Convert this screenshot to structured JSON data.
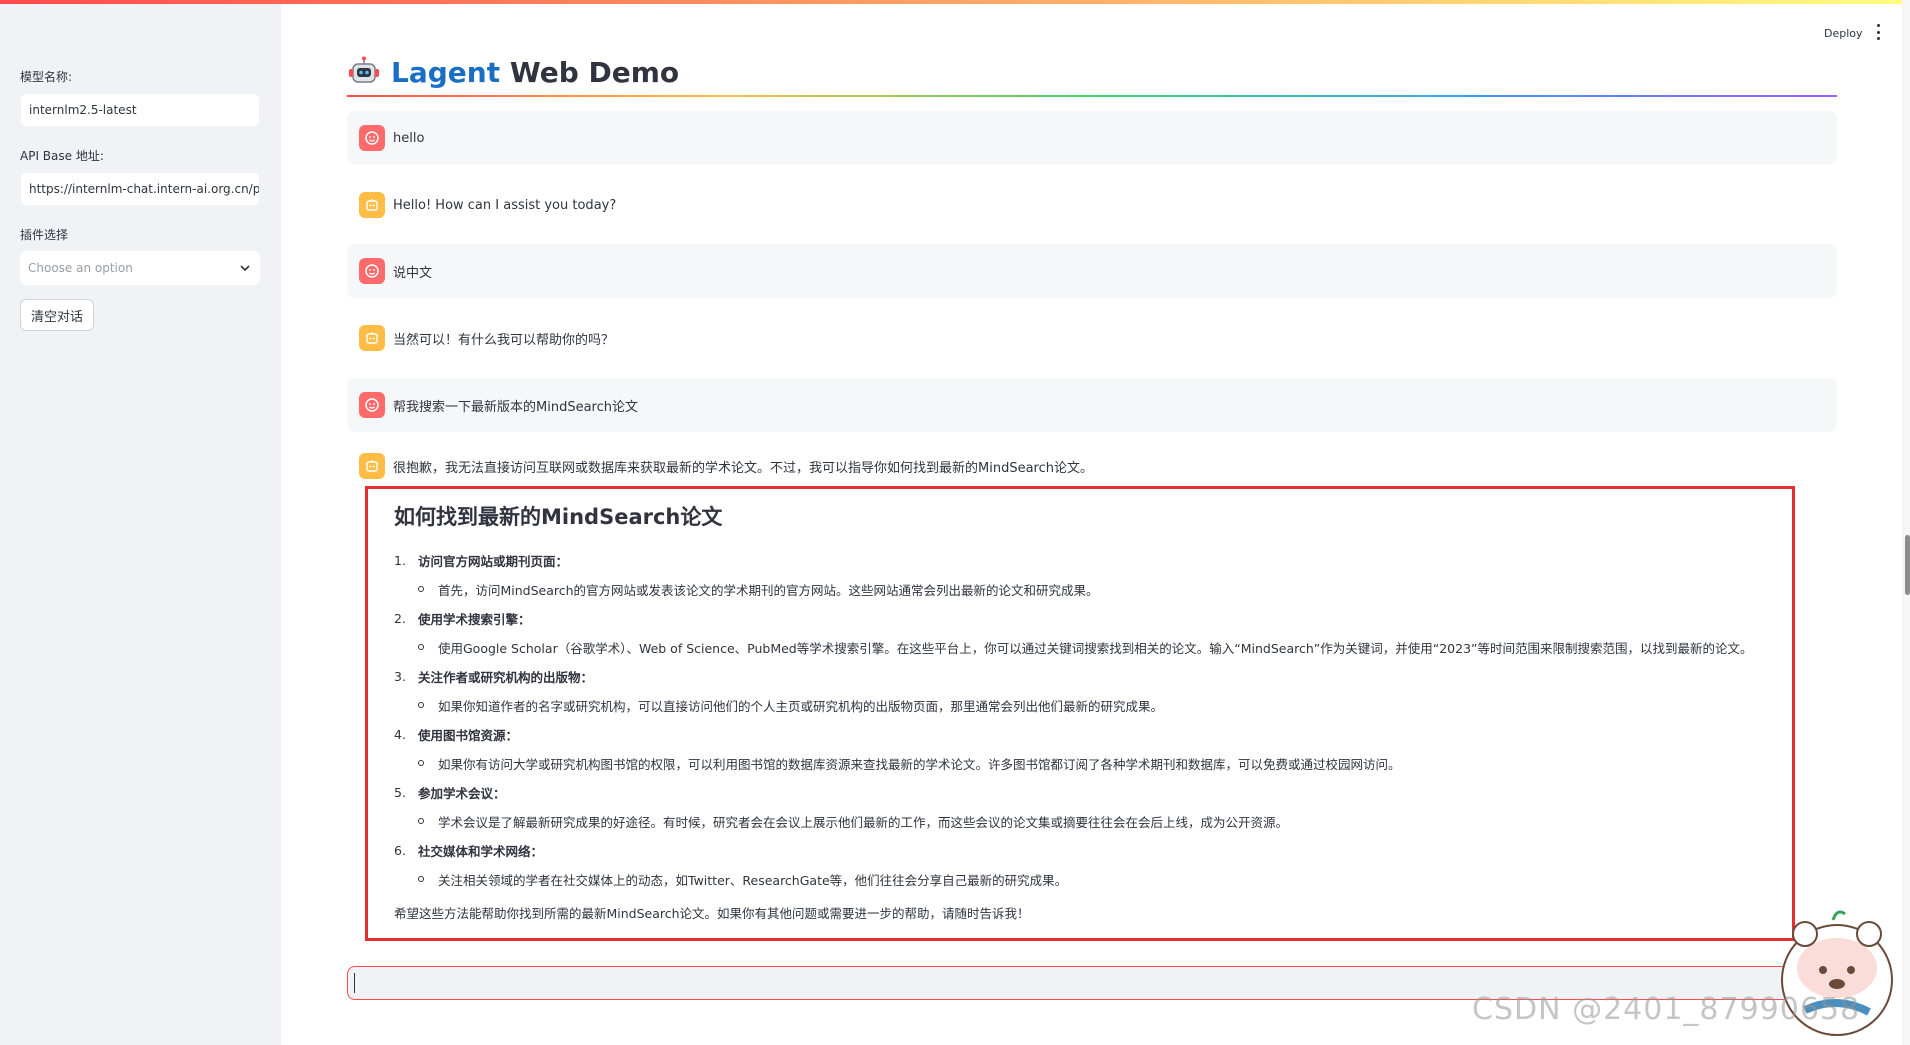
{
  "header": {
    "deploy_label": "Deploy"
  },
  "sidebar": {
    "model_label": "模型名称:",
    "model_value": "internlm2.5-latest",
    "api_label": "API Base 地址:",
    "api_value": "https://internlm-chat.intern-ai.org.cn/pu",
    "plugin_label": "插件选择",
    "plugin_placeholder": "Choose an option",
    "clear_button": "清空对话"
  },
  "main": {
    "title_brand": "Lagent",
    "title_rest": " Web Demo",
    "messages": [
      {
        "role": "user",
        "text": "hello"
      },
      {
        "role": "assistant",
        "text": "Hello! How can I assist you today?"
      },
      {
        "role": "user",
        "text": "说中文"
      },
      {
        "role": "assistant",
        "text": "当然可以！有什么我可以帮助你的吗？"
      },
      {
        "role": "user",
        "text": "帮我搜索一下最新版本的MindSearch论文"
      }
    ],
    "answer": {
      "intro": "很抱歉，我无法直接访问互联网或数据库来获取最新的学术论文。不过，我可以指导你如何找到最新的MindSearch论文。",
      "heading": "如何找到最新的MindSearch论文",
      "steps": [
        {
          "num": "1.",
          "title": "访问官方网站或期刊页面：",
          "detail": "首先，访问MindSearch的官方网站或发表该论文的学术期刊的官方网站。这些网站通常会列出最新的论文和研究成果。"
        },
        {
          "num": "2.",
          "title": "使用学术搜索引擎：",
          "detail": "使用Google Scholar（谷歌学术）、Web of Science、PubMed等学术搜索引擎。在这些平台上，你可以通过关键词搜索找到相关的论文。输入“MindSearch”作为关键词，并使用“2023”等时间范围来限制搜索范围，以找到最新的论文。"
        },
        {
          "num": "3.",
          "title": "关注作者或研究机构的出版物：",
          "detail": "如果你知道作者的名字或研究机构，可以直接访问他们的个人主页或研究机构的出版物页面，那里通常会列出他们最新的研究成果。"
        },
        {
          "num": "4.",
          "title": "使用图书馆资源：",
          "detail": "如果你有访问大学或研究机构图书馆的权限，可以利用图书馆的数据库资源来查找最新的学术论文。许多图书馆都订阅了各种学术期刊和数据库，可以免费或通过校园网访问。"
        },
        {
          "num": "5.",
          "title": "参加学术会议：",
          "detail": "学术会议是了解最新研究成果的好途径。有时候，研究者会在会议上展示他们最新的工作，而这些会议的论文集或摘要往往会在会后上线，成为公开资源。"
        },
        {
          "num": "6.",
          "title": "社交媒体和学术网络：",
          "detail": "关注相关领域的学者在社交媒体上的动态，如Twitter、ResearchGate等，他们往往会分享自己最新的研究成果。"
        }
      ],
      "closing": "希望这些方法能帮助你找到所需的最新MindSearch论文。如果你有其他问题或需要进一步的帮助，请随时告诉我！"
    }
  },
  "watermark": "CSDN @2401_87990658",
  "colors": {
    "accent": "#ff4b4b",
    "brand_blue": "#1a6fc4",
    "user_avatar": "#ff6b6b",
    "bot_avatar": "#ffbd45",
    "highlight_box": "#e62e2e"
  }
}
